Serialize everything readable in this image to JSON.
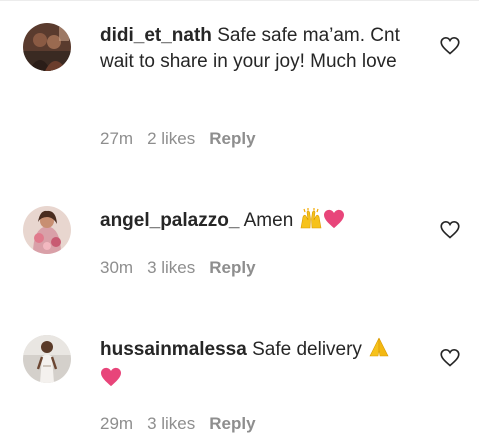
{
  "comments": [
    {
      "username": "didi_et_nath",
      "text": "Safe safe ma’am. Cnt wait to share in your joy! Much love",
      "time": "27m",
      "likes": "2 likes",
      "reply_label": "Reply",
      "avatar_icon": "avatar-photo-icon"
    },
    {
      "username": "angel_palazzo_",
      "text": "Amen",
      "time": "30m",
      "likes": "3 likes",
      "reply_label": "Reply",
      "avatar_icon": "avatar-photo-icon",
      "emojis": [
        "raising-hands-icon",
        "pink-heart-icon"
      ]
    },
    {
      "username": "hussainmalessa",
      "text": "Safe delivery",
      "time": "29m",
      "likes": "3 likes",
      "reply_label": "Reply",
      "avatar_icon": "avatar-photo-icon",
      "emojis": [
        "folded-hands-icon",
        "pink-heart-icon"
      ]
    }
  ],
  "colors": {
    "text": "#262626",
    "meta": "#8e8e8e",
    "heart_emoji": "#e8457a",
    "emoji_yellow": "#f6c21c"
  }
}
